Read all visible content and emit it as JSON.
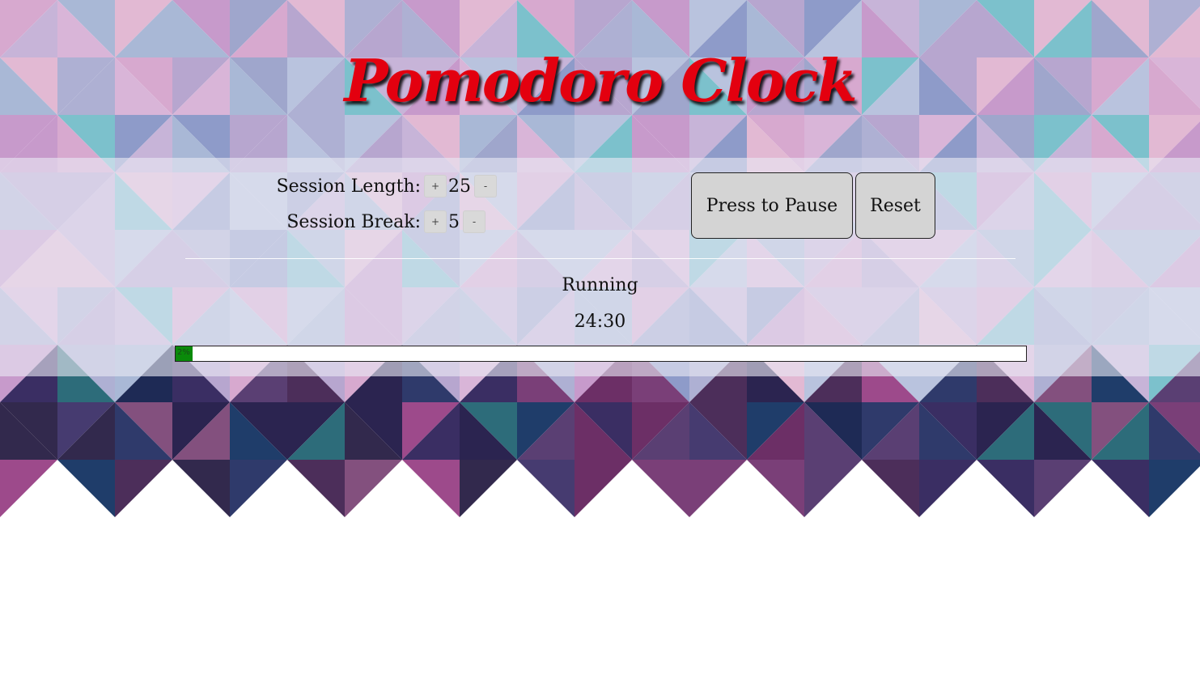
{
  "app": {
    "title": "Pomodoro Clock"
  },
  "settings": {
    "session_length_label": "Session Length:",
    "session_length_value": "25",
    "session_break_label": "Session Break:",
    "session_break_value": "5",
    "increment_label": "+",
    "decrement_label": "-"
  },
  "actions": {
    "pause_label": "Press to Pause",
    "reset_label": "Reset"
  },
  "timer": {
    "status": "Running",
    "time": "24:30",
    "progress_percent": 2,
    "progress_text": "2%"
  },
  "colors": {
    "title": "#e3000f",
    "progress_fill": "#0a8a0a"
  }
}
